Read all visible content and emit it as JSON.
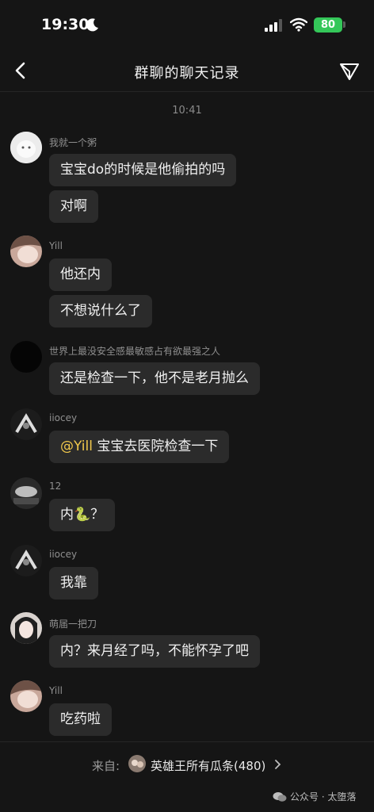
{
  "status_bar": {
    "time": "19:30",
    "battery": "80",
    "icons": [
      "moon-icon",
      "signal-icon",
      "wifi-icon",
      "battery-icon"
    ]
  },
  "nav": {
    "title": "群聊的聊天记录",
    "back_icon": "back-chevron-icon",
    "share_icon": "share-icon"
  },
  "timestamp": "10:41",
  "messages": [
    {
      "sender": "我就一个粥",
      "bubbles": [
        "宝宝do的时候是他偷拍的吗",
        "对啊"
      ]
    },
    {
      "sender": "Yill",
      "bubbles": [
        "他还内",
        "不想说什么了"
      ]
    },
    {
      "sender": "世界上最没安全感最敏感占有欲最强之人",
      "bubbles": [
        "还是检查一下，他不是老月抛么"
      ]
    },
    {
      "sender": "iiocey",
      "mention": "@Yill",
      "bubbles": [
        "宝宝去医院检查一下"
      ]
    },
    {
      "sender": "12",
      "bubbles": [
        "内🐍？"
      ]
    },
    {
      "sender": "iiocey",
      "bubbles": [
        "我靠"
      ]
    },
    {
      "sender": "萌届一把刀",
      "bubbles": [
        "内？来月经了吗，不能怀孕了吧"
      ]
    },
    {
      "sender": "Yill",
      "bubbles": [
        "吃药啦"
      ]
    }
  ],
  "footer": {
    "from_label": "来自:",
    "group_name": "英雄王所有瓜条(480)"
  },
  "watermark": "公众号 · 太堕落",
  "colors": {
    "background": "#151515",
    "bubble": "#2b2b2b",
    "mention": "#f2c94c",
    "battery": "#34c759"
  }
}
